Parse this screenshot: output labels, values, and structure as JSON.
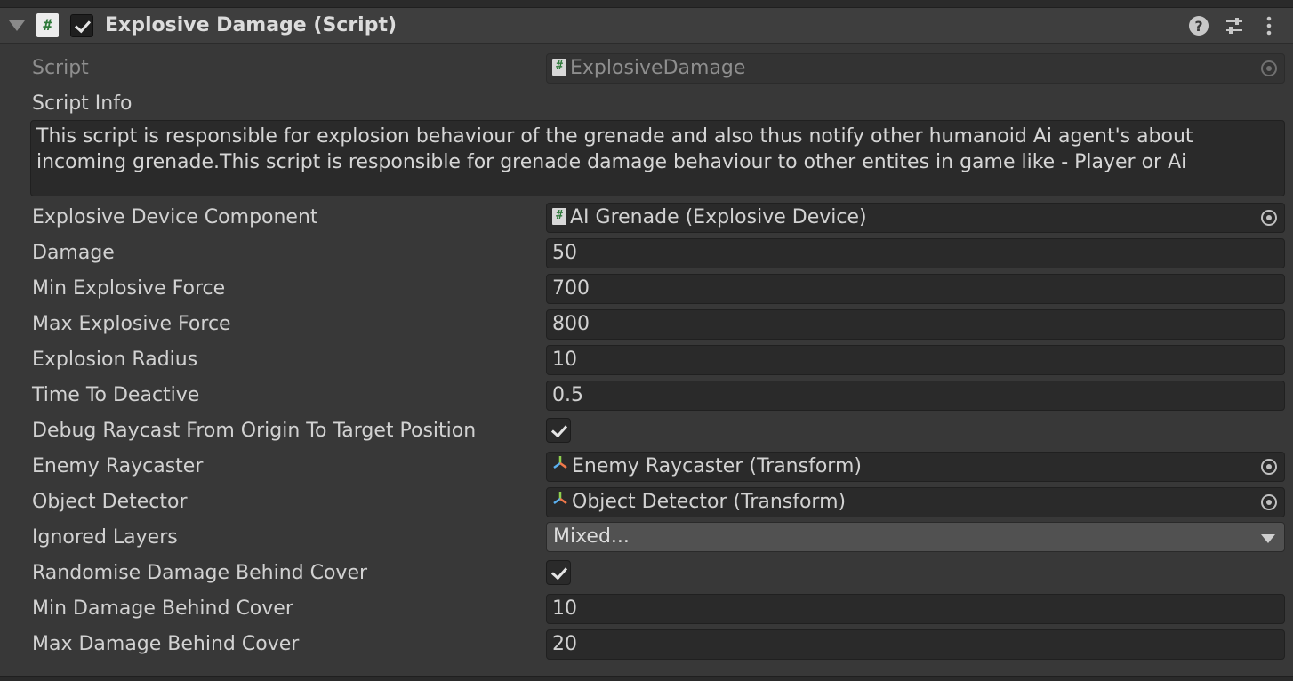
{
  "header": {
    "title": "Explosive Damage (Script)",
    "badge_glyph": "#",
    "enabled": true,
    "icons": [
      "foldout-arrow-icon",
      "script-icon",
      "help-icon",
      "preset-icon",
      "kebab-menu-icon"
    ]
  },
  "fields": {
    "script": {
      "label": "Script",
      "value": "ExplosiveDamage"
    },
    "script_info": {
      "label": "Script Info",
      "value": "This script is responsible for explosion behaviour of the grenade and also thus notify other humanoid Ai agent's about incoming grenade.This script is responsible for grenade damage behaviour to other entites in game like - Player or Ai"
    },
    "explosive_device": {
      "label": "Explosive Device Component",
      "value": "AI Grenade (Explosive Device)"
    },
    "damage": {
      "label": "Damage",
      "value": "50"
    },
    "min_force": {
      "label": "Min Explosive Force",
      "value": "700"
    },
    "max_force": {
      "label": "Max Explosive Force",
      "value": "800"
    },
    "radius": {
      "label": "Explosion Radius",
      "value": "10"
    },
    "time_deactive": {
      "label": "Time To Deactive",
      "value": "0.5"
    },
    "debug_raycast": {
      "label": "Debug Raycast From Origin To Target Position",
      "checked": true
    },
    "enemy_raycaster": {
      "label": "Enemy Raycaster",
      "value": "Enemy Raycaster (Transform)"
    },
    "object_detector": {
      "label": "Object Detector",
      "value": "Object Detector (Transform)"
    },
    "ignored_layers": {
      "label": "Ignored Layers",
      "value": "Mixed..."
    },
    "randomise_damage": {
      "label": "Randomise Damage Behind Cover",
      "checked": true
    },
    "min_damage_cover": {
      "label": "Min Damage Behind Cover",
      "value": "10"
    },
    "max_damage_cover": {
      "label": "Max Damage Behind Cover",
      "value": "20"
    }
  },
  "colors": {
    "panel_bg": "#383838",
    "field_bg": "#2a2a2a",
    "script_green": "#2f7a3b",
    "dropdown_bg": "#515151"
  }
}
